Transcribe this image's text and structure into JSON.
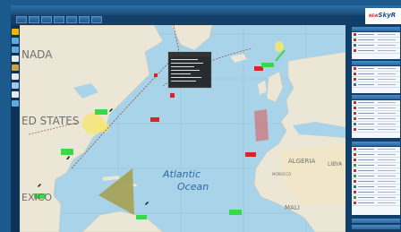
{
  "app": {
    "title": "",
    "status": "",
    "logo": {
      "brand": "SkyR",
      "small": "NEW"
    }
  },
  "menu": {
    "items": [
      "",
      "",
      "",
      "",
      "",
      "",
      ""
    ]
  },
  "map": {
    "labels": {
      "canada": "NADA",
      "united_states": "ED STATES",
      "mexico": "EXICO",
      "ocean_line1": "Atlantic",
      "ocean_line2": "Ocean",
      "algeria": "ALGERIA",
      "libya": "LIBYA",
      "morocco": "MOROCCO",
      "mali": "MALI"
    }
  },
  "colors": {
    "ocean": "#a9d3e8",
    "land": "#ece6d6",
    "accent": "#2d6fa6",
    "panel": "#123d66",
    "flight_marker": "#d2262a",
    "label_green": "#39d94a",
    "label_yellow": "#f3e05a"
  },
  "icons": [
    "plane-icon",
    "zoom-in-icon",
    "zoom-out-icon",
    "layers-icon",
    "measure-icon"
  ]
}
